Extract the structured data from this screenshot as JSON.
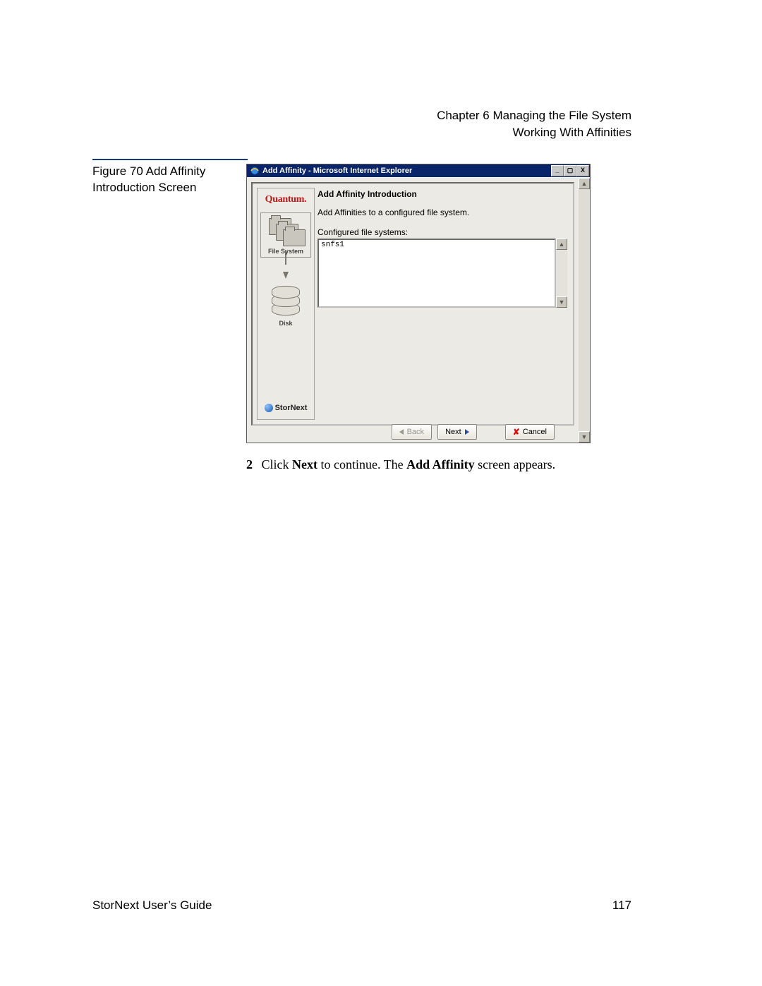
{
  "header": {
    "chapter": "Chapter 6  Managing the File System",
    "section": "Working With Affinities"
  },
  "figure": {
    "label": "Figure 70  Add Affinity Introduction Screen"
  },
  "window": {
    "title": "Add Affinity - Microsoft Internet Explorer",
    "buttons": {
      "min": "_",
      "max": "▢",
      "close": "X"
    },
    "sidebar": {
      "brand": "Quantum.",
      "label_fs": "File System",
      "label_disk": "Disk",
      "product": "StorNext"
    },
    "main": {
      "heading": "Add Affinity Introduction",
      "description": "Add Affinities to a configured file system.",
      "list_label": "Configured file systems:",
      "items": [
        "snfs1"
      ]
    },
    "nav": {
      "back": "Back",
      "next": "Next",
      "cancel": "Cancel"
    }
  },
  "step": {
    "num": "2",
    "pre": "Click ",
    "b1": "Next",
    "mid": " to continue. The ",
    "b2": "Add Affinity",
    "post": " screen appears."
  },
  "footer": {
    "left": "StorNext User’s Guide",
    "page": "117"
  }
}
